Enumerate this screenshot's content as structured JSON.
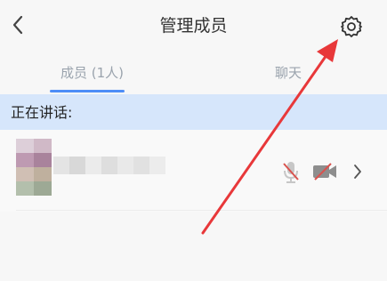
{
  "header": {
    "title": "管理成员",
    "back_icon": "chevron-left-icon",
    "settings_icon": "gear-icon"
  },
  "tabs": [
    {
      "label": "成员 (1人)",
      "selected": true
    },
    {
      "label": "聊天",
      "selected": false
    }
  ],
  "speaking": {
    "label": "正在讲话:"
  },
  "member": {
    "mic_icon": "mic-muted-icon",
    "camera_icon": "camera-off-icon",
    "chevron_icon": "chevron-right-icon"
  },
  "colors": {
    "accent": "#4e8ef7",
    "speaking_bg": "#d6e6fb",
    "annotation_arrow": "#e8383a",
    "muted_red": "#d9534f"
  }
}
